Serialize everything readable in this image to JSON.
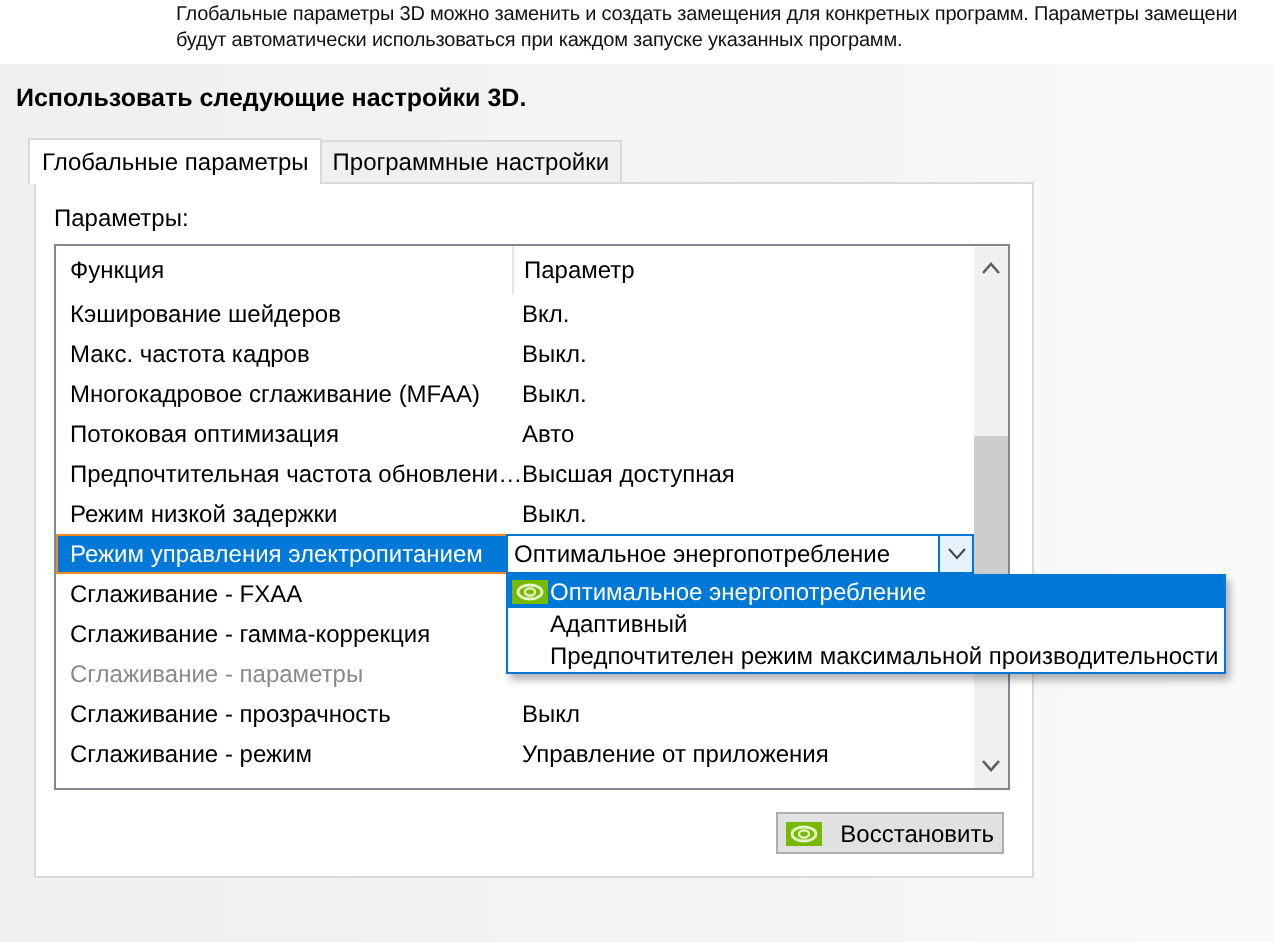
{
  "description": {
    "lines": [
      "Глобальные параметры 3D можно заменить и создать замещения для конкретных программ. Параметры замещени",
      "будут автоматически использоваться при каждом запуске указанных программ."
    ]
  },
  "heading": "Использовать следующие настройки 3D.",
  "tabs": [
    {
      "label": "Глобальные параметры",
      "selected": true
    },
    {
      "label": "Программные настройки",
      "selected": false
    }
  ],
  "panel": {
    "label": "Параметры:",
    "table": {
      "columns": [
        "Функция",
        "Параметр"
      ],
      "rows": [
        {
          "function": "Кэширование шейдеров",
          "value": "Вкл.",
          "selected": false,
          "disabled": false
        },
        {
          "function": "Макс. частота кадров",
          "value": "Выкл.",
          "selected": false,
          "disabled": false
        },
        {
          "function": "Многокадровое сглаживание (MFAA)",
          "value": "Выкл.",
          "selected": false,
          "disabled": false
        },
        {
          "function": "Потоковая оптимизация",
          "value": "Авто",
          "selected": false,
          "disabled": false
        },
        {
          "function": "Предпочтительная частота обновлени…",
          "value": "Высшая доступная",
          "selected": false,
          "disabled": false
        },
        {
          "function": "Режим низкой задержки",
          "value": "Выкл.",
          "selected": false,
          "disabled": false
        },
        {
          "function": "Режим управления электропитанием",
          "value": "Оптимальное энергопотребление",
          "selected": true,
          "disabled": false
        },
        {
          "function": "Сглаживание - FXAA",
          "selected": false,
          "disabled": false
        },
        {
          "function": "Сглаживание - гамма-коррекция",
          "selected": false,
          "disabled": false
        },
        {
          "function": "Сглаживание - параметры",
          "selected": false,
          "disabled": true
        },
        {
          "function": "Сглаживание - прозрачность",
          "value": "Выкл",
          "selected": false,
          "disabled": false
        },
        {
          "function": "Сглаживание - режим",
          "value": "Управление от приложения",
          "selected": false,
          "disabled": false
        }
      ]
    },
    "dropdown": {
      "options": [
        {
          "label": "Оптимальное энергопотребление",
          "selected": true,
          "recommended": true
        },
        {
          "label": "Адаптивный",
          "selected": false,
          "recommended": false
        },
        {
          "label": "Предпочтителен режим максимальной производительности",
          "selected": false,
          "recommended": false
        }
      ]
    },
    "restore_button": "Восстановить"
  }
}
